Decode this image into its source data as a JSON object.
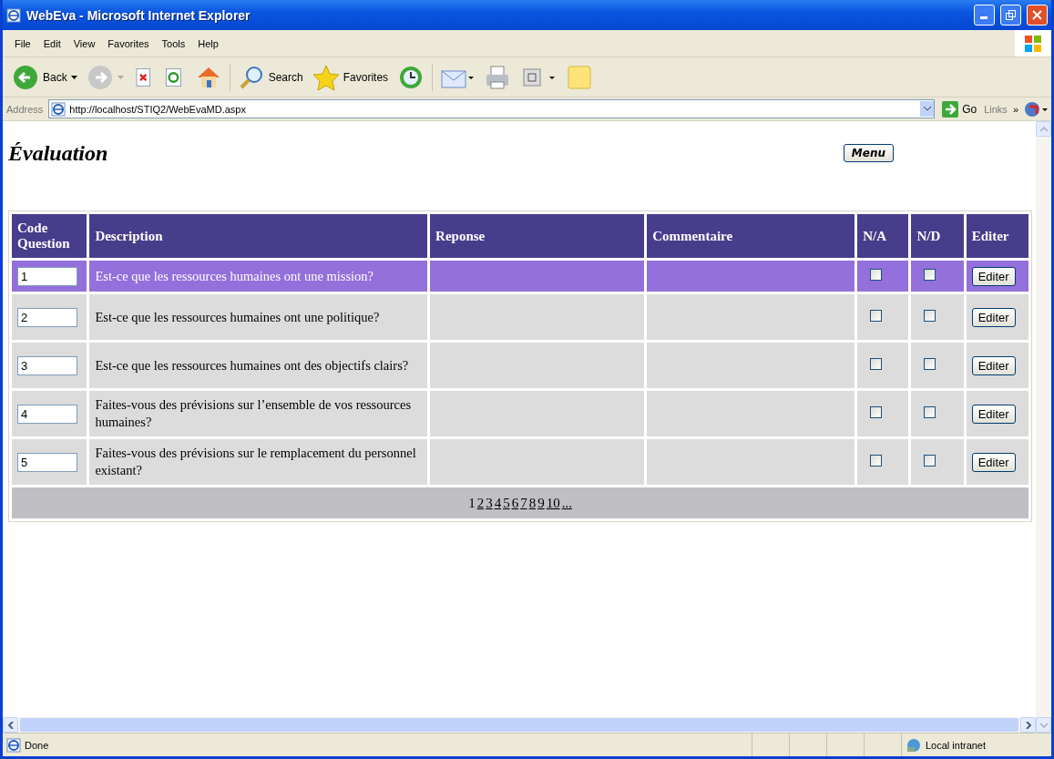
{
  "window": {
    "title": "WebEva - Microsoft Internet Explorer"
  },
  "menu": [
    "File",
    "Edit",
    "View",
    "Favorites",
    "Tools",
    "Help"
  ],
  "toolbar": [
    {
      "kind": "back",
      "label": "Back"
    },
    {
      "kind": "forward"
    },
    {
      "kind": "stop"
    },
    {
      "kind": "refresh"
    },
    {
      "kind": "home"
    },
    {
      "kind": "search",
      "label": "Search"
    },
    {
      "kind": "favorites",
      "label": "Favorites"
    },
    {
      "kind": "history"
    },
    {
      "kind": "mail"
    },
    {
      "kind": "print"
    },
    {
      "kind": "frame"
    },
    {
      "kind": "note"
    }
  ],
  "address": {
    "label": "Address",
    "value": "http://localhost/STIQ2/WebEvaMD.aspx",
    "go": "Go",
    "links": "Links",
    "more": "»"
  },
  "page": {
    "heading": "Évaluation",
    "menu_button": "Menu",
    "table": {
      "columns": [
        "Code Question",
        "Description",
        "Reponse",
        "Commentaire",
        "N/A",
        "N/D",
        "Editer"
      ],
      "rows": [
        {
          "code": "1",
          "description": "Est-ce que les ressources humaines ont une mission?",
          "na": false,
          "nd": false,
          "button": "Editer",
          "selected": true
        },
        {
          "code": "2",
          "description": "Est-ce que les ressources humaines ont une politique?",
          "na": false,
          "nd": false,
          "button": "Editer",
          "selected": false
        },
        {
          "code": "3",
          "description": "Est-ce que les ressources humaines ont des objectifs clairs?",
          "na": false,
          "nd": false,
          "button": "Editer",
          "selected": false
        },
        {
          "code": "4",
          "description": "Faites-vous des prévisions sur l’ensemble de vos ressources humaines?",
          "na": false,
          "nd": false,
          "button": "Editer",
          "selected": false
        },
        {
          "code": "5",
          "description": "Faites-vous des prévisions sur le remplacement du personnel existant?",
          "na": false,
          "nd": false,
          "button": "Editer",
          "selected": false
        }
      ],
      "pages": [
        {
          "label": "1",
          "selected": true
        },
        {
          "label": "2",
          "selected": false
        },
        {
          "label": "3",
          "selected": false
        },
        {
          "label": "4",
          "selected": false
        },
        {
          "label": "5",
          "selected": false
        },
        {
          "label": "6",
          "selected": false
        },
        {
          "label": "7",
          "selected": false
        },
        {
          "label": "8",
          "selected": false
        },
        {
          "label": "9",
          "selected": false
        },
        {
          "label": "10",
          "selected": false
        },
        {
          "label": "...",
          "selected": false
        }
      ]
    }
  },
  "status_bar": {
    "text": "Done",
    "zone": "Local intranet"
  }
}
